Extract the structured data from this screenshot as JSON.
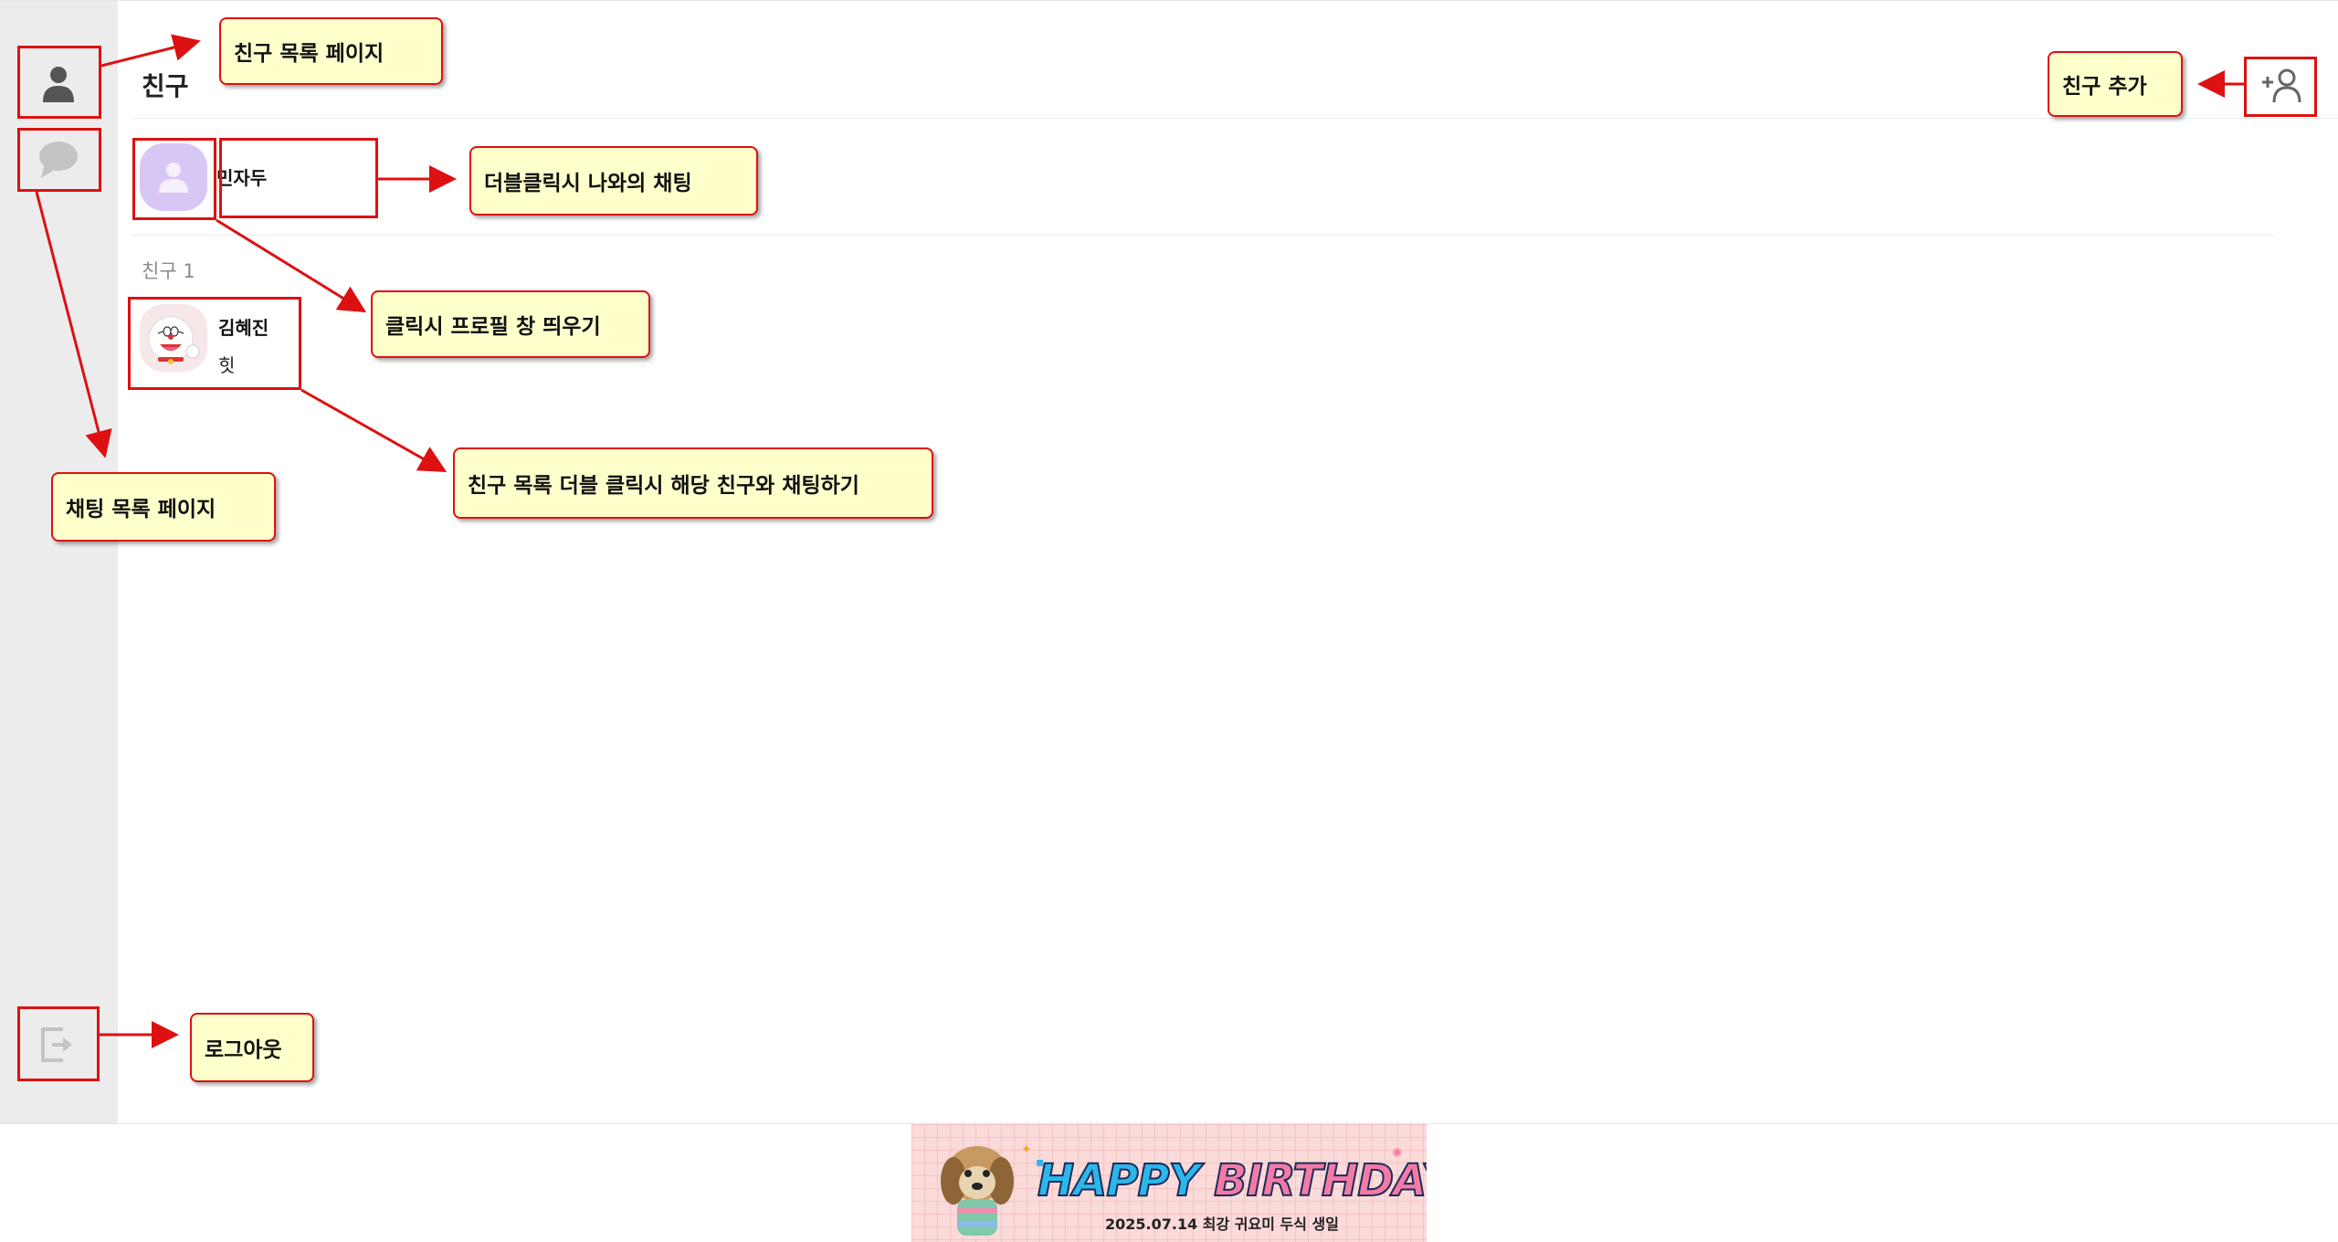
{
  "page": {
    "title": "친구"
  },
  "me": {
    "name": "민자두"
  },
  "section": {
    "label": "친구 1"
  },
  "friends": [
    {
      "name": "김혜진",
      "status": "힛"
    }
  ],
  "banner": {
    "headline_a": "HAPPY",
    "headline_b": "BIRTHDAY",
    "subtitle": "2025.07.14 최강 귀요미 두식 생일"
  },
  "annotations": {
    "friends_page": "친구 목록 페이지",
    "add_friend": "친구 추가",
    "self_chat": "더블클릭시 나와의 채팅",
    "profile": "클릭시 프로필 창 띄우기",
    "chat_list": "채팅 목록 페이지",
    "friend_chat": "친구 목록 더블 클릭시 해당 친구와 채팅하기",
    "logout": "로그아웃"
  },
  "icons": {
    "friends_tab": "person-icon",
    "chats_tab": "chat-bubble-icon",
    "logout": "logout-icon",
    "add_friend": "add-person-icon"
  },
  "colors": {
    "sidebar": "#ececec",
    "annotation_border": "#dd1111",
    "annotation_fill": "#ffffcc",
    "me_avatar": "#d8c7f4"
  }
}
